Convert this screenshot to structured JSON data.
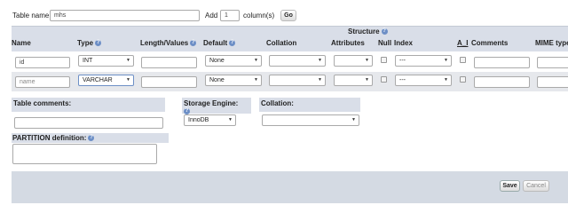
{
  "top": {
    "table_name_label": "Table name:",
    "table_name_value": "mhs",
    "add_label": "Add",
    "add_count": "1",
    "columns_label": "column(s)",
    "go_label": "Go"
  },
  "structure": {
    "title": "Structure",
    "headers": {
      "name": "Name",
      "type": "Type",
      "length": "Length/Values",
      "default": "Default",
      "collation": "Collation",
      "attributes": "Attributes",
      "null": "Null",
      "index": "Index",
      "ai": "A_I",
      "comments": "Comments",
      "mime": "MIME type"
    },
    "rows": [
      {
        "name": "id",
        "type": "INT",
        "default": "None",
        "index": "---"
      },
      {
        "name": "name",
        "type": "VARCHAR",
        "default": "None",
        "index": "---"
      }
    ]
  },
  "options": {
    "table_comments_label": "Table comments:",
    "storage_engine_label": "Storage Engine:",
    "storage_engine_value": "InnoDB",
    "collation_label": "Collation:",
    "partition_label": "PARTITION definition:"
  },
  "footer": {
    "save_label": "Save",
    "cancel_label": "Cancel"
  },
  "colors": {
    "header_bg": "#d9dee8",
    "row_bg": "#e6e8ec",
    "footer_bg": "#d4dae3",
    "help_icon": "#6d8fc6"
  }
}
